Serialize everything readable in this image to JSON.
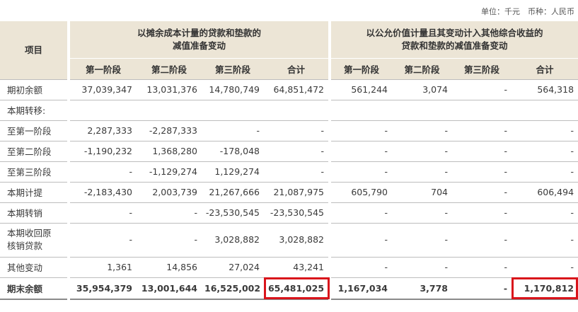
{
  "unit_note": "单位：千元　币种：人民币",
  "headers": {
    "item": "项目",
    "group1": "以摊余成本计量的贷款和垫款的减值准备变动",
    "group1_line1": "以摊余成本计量的贷款和垫款的",
    "group1_line2": "减值准备变动",
    "group2_line1": "以公允价值计量且其变动计入其他综合收益的",
    "group2_line2": "贷款和垫款的减值准备变动",
    "sub": [
      "第一阶段",
      "第二阶段",
      "第三阶段",
      "合计",
      "第一阶段",
      "第二阶段",
      "第三阶段",
      "合计"
    ]
  },
  "rows": [
    {
      "label": "期初余额",
      "cells": [
        "37,039,347",
        "13,031,376",
        "14,780,749",
        "64,851,472",
        "561,244",
        "3,074",
        "-",
        "564,318"
      ]
    },
    {
      "label": "本期转移:",
      "cells": [
        "",
        "",
        "",
        "",
        "",
        "",
        "",
        ""
      ]
    },
    {
      "label": "至第一阶段",
      "cells": [
        "2,287,333",
        "-2,287,333",
        "-",
        "-",
        "-",
        "-",
        "-",
        "-"
      ]
    },
    {
      "label": "至第二阶段",
      "cells": [
        "-1,190,232",
        "1,368,280",
        "-178,048",
        "-",
        "-",
        "-",
        "-",
        "-"
      ]
    },
    {
      "label": "至第三阶段",
      "cells": [
        "-",
        "-1,129,274",
        "1,129,274",
        "-",
        "-",
        "-",
        "-",
        "-"
      ]
    },
    {
      "label": "本期计提",
      "cells": [
        "-2,183,430",
        "2,003,739",
        "21,267,666",
        "21,087,975",
        "605,790",
        "704",
        "-",
        "606,494"
      ]
    },
    {
      "label": "本期转销",
      "cells": [
        "-",
        "-",
        "-23,530,545",
        "-23,530,545",
        "-",
        "-",
        "-",
        "-"
      ]
    },
    {
      "label_line1": "本期收回原",
      "label_line2": "核销贷款",
      "cells": [
        "-",
        "-",
        "3,028,882",
        "3,028,882",
        "-",
        "-",
        "-",
        "-"
      ]
    },
    {
      "label": "其他变动",
      "cells": [
        "1,361",
        "14,856",
        "27,024",
        "43,241",
        "-",
        "-",
        "-",
        "-"
      ]
    },
    {
      "label": "期末余额",
      "cells": [
        "35,954,379",
        "13,001,644",
        "16,525,002",
        "65,481,025",
        "1,167,034",
        "3,778",
        "-",
        "1,170,812"
      ]
    }
  ],
  "colors": {
    "header_bg": "#ece5d6",
    "highlight": "#d9141b"
  }
}
